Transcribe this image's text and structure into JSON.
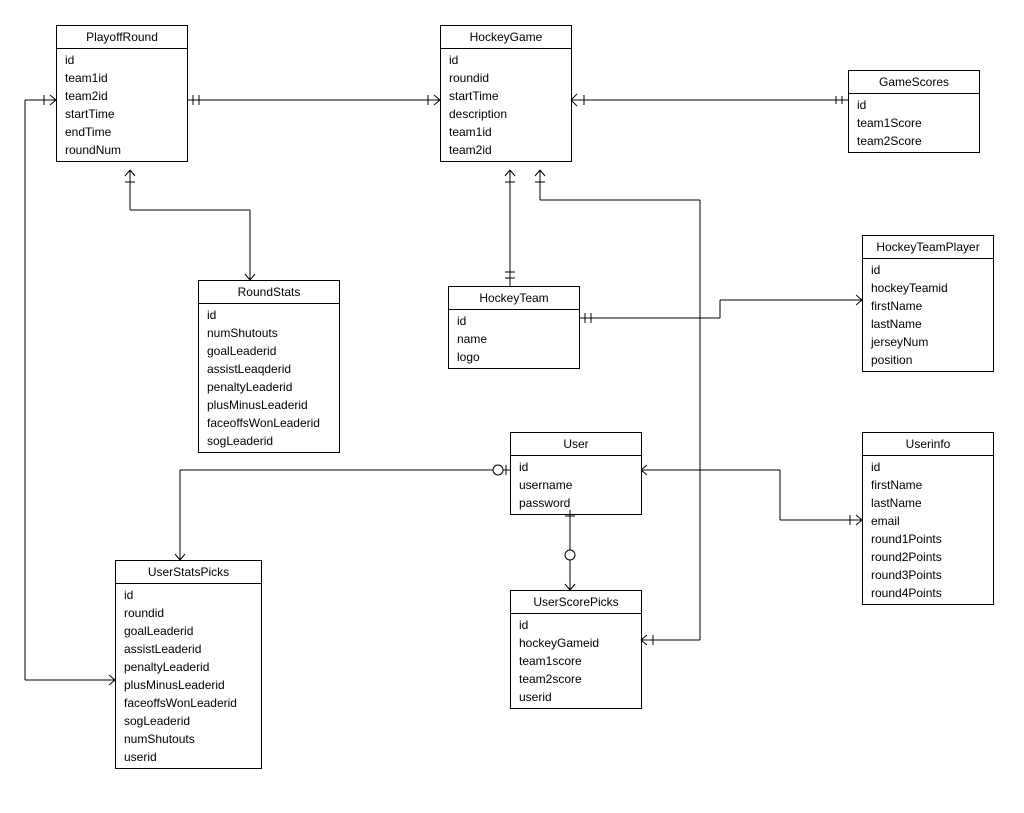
{
  "entities": {
    "playoffRound": {
      "title": "PlayoffRound",
      "fields": [
        "id",
        "team1id",
        "team2id",
        "startTime",
        "endTime",
        "roundNum"
      ]
    },
    "hockeyGame": {
      "title": "HockeyGame",
      "fields": [
        "id",
        "roundid",
        "startTime",
        "description",
        "team1id",
        "team2id"
      ]
    },
    "gameScores": {
      "title": "GameScores",
      "fields": [
        "id",
        "team1Score",
        "team2Score"
      ]
    },
    "roundStats": {
      "title": "RoundStats",
      "fields": [
        "id",
        "numShutouts",
        "goalLeaderid",
        "assistLeaqderid",
        "penaltyLeaderid",
        "plusMinusLeaderid",
        "faceoffsWonLeaderid",
        "sogLeaderid"
      ]
    },
    "hockeyTeam": {
      "title": "HockeyTeam",
      "fields": [
        "id",
        "name",
        "logo"
      ]
    },
    "hockeyTeamPlayer": {
      "title": "HockeyTeamPlayer",
      "fields": [
        "id",
        "hockeyTeamid",
        "firstName",
        "lastName",
        "jerseyNum",
        "position"
      ]
    },
    "user": {
      "title": "User",
      "fields": [
        "id",
        "username",
        "password"
      ]
    },
    "userinfo": {
      "title": "Userinfo",
      "fields": [
        "id",
        "firstName",
        "lastName",
        "email",
        "round1Points",
        "round2Points",
        "round3Points",
        "round4Points"
      ]
    },
    "userStatsPicks": {
      "title": "UserStatsPicks",
      "fields": [
        "id",
        "roundid",
        "goalLeaderid",
        "assistLeaderid",
        "penaltyLeaderid",
        "plusMinusLeaderid",
        "faceoffsWonLeaderid",
        "sogLeaderid",
        "numShutouts",
        "userid"
      ]
    },
    "userScorePicks": {
      "title": "UserScorePicks",
      "fields": [
        "id",
        "hockeyGameid",
        "team1score",
        "team2score",
        "userid"
      ]
    }
  }
}
